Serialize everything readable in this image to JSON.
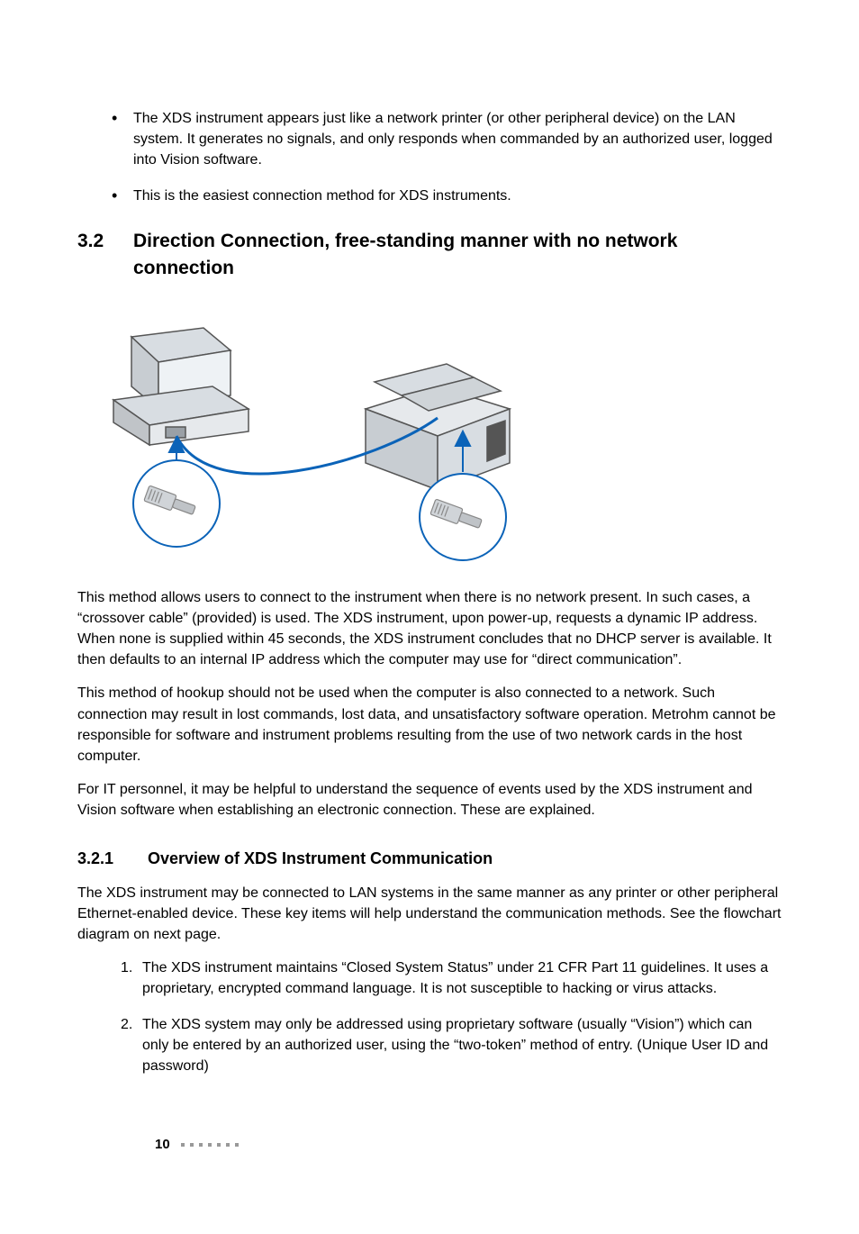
{
  "bullets_top": [
    "The XDS instrument appears just like a network printer (or other peripheral device) on the LAN system. It generates no signals, and only responds when commanded by an authorized user, logged into Vision software.",
    "This is the easiest connection method for XDS instruments."
  ],
  "section": {
    "num": "3.2",
    "title": "Direction Connection, free-standing manner with no network connection"
  },
  "paras": [
    "This method allows users to connect to the instrument when there is no network present. In such cases, a “crossover cable” (provided) is used. The XDS instrument, upon power-up, requests a dynamic IP address. When none is supplied within 45 seconds, the XDS instrument concludes that no DHCP server is available. It then defaults to an internal IP address which the computer may use for “direct communication”.",
    "This method of hookup should not be used when the computer is also connected to a network. Such connection may result in lost commands, lost data, and unsatisfactory software operation. Metrohm cannot be responsible for software and instrument problems resulting from the use of two network cards in the host computer.",
    "For IT personnel, it may be helpful to understand the sequence of events used by the XDS instrument and Vision software when establishing an electronic connection. These are explained."
  ],
  "subsection": {
    "num": "3.2.1",
    "title": "Overview of XDS Instrument Communication"
  },
  "sub_para": "The XDS instrument may be connected to LAN systems in the same manner as any printer or other peripheral Ethernet-enabled device. These key items will help understand the communication methods. See the flowchart diagram on next page.",
  "numlist": [
    {
      "n": "1.",
      "t": "The XDS instrument maintains “Closed System Status” under 21 CFR Part 11 guidelines. It uses a proprietary, encrypted command language. It is not susceptible to hacking or virus attacks."
    },
    {
      "n": "2.",
      "t": "The XDS system may only be addressed using proprietary software (usually “Vision”) which can only be entered by an authorized user, using the “two-token” method of entry. (Unique User ID and password)"
    }
  ],
  "page_number": "10"
}
